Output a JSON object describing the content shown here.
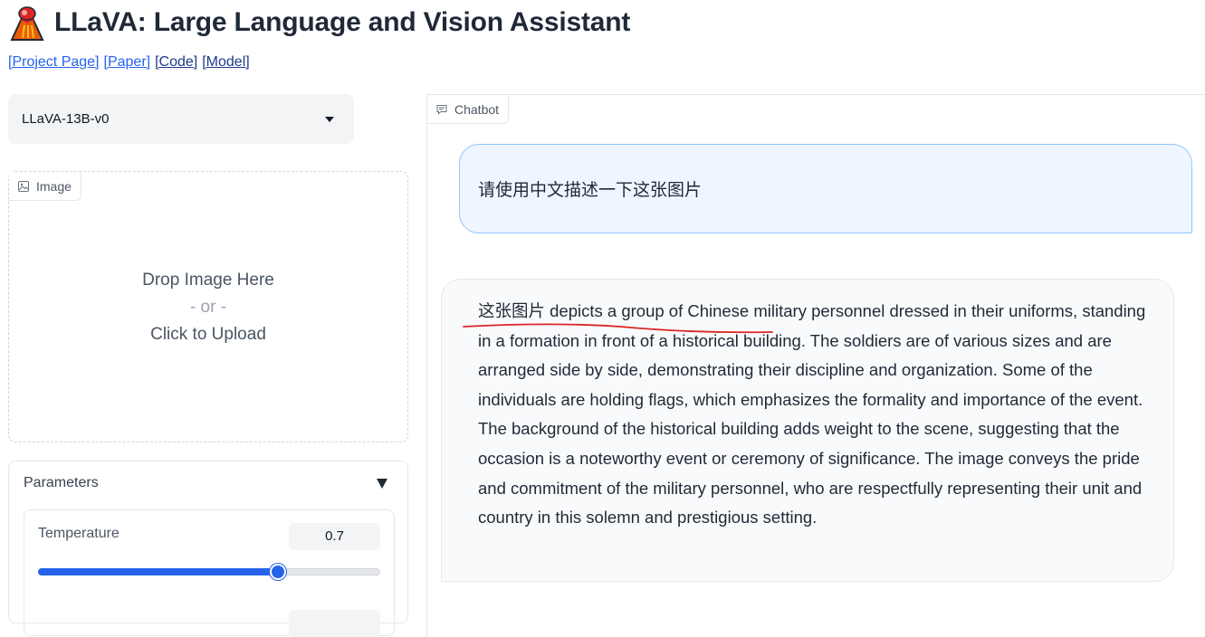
{
  "app": {
    "title": "LLaVA: Large Language and Vision Assistant"
  },
  "links": [
    {
      "label": "[Project Page]"
    },
    {
      "label": "[Paper]"
    },
    {
      "label": "[Code]"
    },
    {
      "label": "[Model]"
    }
  ],
  "model_select": {
    "value": "LLaVA-13B-v0"
  },
  "image_upload": {
    "label": "Image",
    "drop_text": "Drop Image Here",
    "or_text": "- or -",
    "click_text": "Click to Upload"
  },
  "parameters": {
    "title": "Parameters",
    "temperature": {
      "label": "Temperature",
      "value": "0.7",
      "fraction": 0.7
    }
  },
  "chatbot": {
    "label": "Chatbot",
    "messages": [
      {
        "role": "user",
        "text": "请使用中文描述一下这张图片"
      },
      {
        "role": "assistant",
        "paragraph_1": "这张图片 depicts a group of Chinese military personnel dressed in their uniforms, standing in a formation in front of a historical building. The soldiers are of various sizes and are arranged side by side, demonstrating their discipline and organization. Some of the individuals are holding flags, which emphasizes the formality and importance of the event.",
        "paragraph_2": "The background of the historical building adds weight to the scene, suggesting that the occasion is a noteworthy event or ceremony of significance. The image conveys the pride and commitment of the military personnel, who are respectfully representing their unit and country in this solemn and prestigious setting."
      }
    ]
  },
  "colors": {
    "accent": "#2563eb",
    "user_bubble": "#eff6ff",
    "annotation": "#dc2626"
  }
}
